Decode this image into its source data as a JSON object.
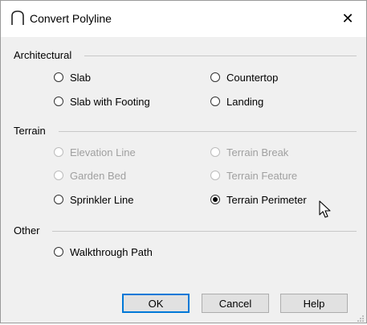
{
  "window": {
    "title": "Convert Polyline",
    "icon": "polyline-arc-icon",
    "close_label": "✕"
  },
  "groups": [
    {
      "label": "Architectural"
    },
    {
      "label": "Terrain"
    },
    {
      "label": "Other"
    }
  ],
  "options": {
    "slab": "Slab",
    "countertop": "Countertop",
    "slab_with_footing": "Slab with Footing",
    "landing": "Landing",
    "elevation_line": "Elevation Line",
    "terrain_break": "Terrain Break",
    "garden_bed": "Garden Bed",
    "terrain_feature": "Terrain Feature",
    "sprinkler_line": "Sprinkler Line",
    "terrain_perimeter": "Terrain Perimeter",
    "walkthrough_path": "Walkthrough Path"
  },
  "selected_option": "Terrain Perimeter",
  "buttons": {
    "ok": "OK",
    "cancel": "Cancel",
    "help": "Help"
  },
  "colors": {
    "default_button_border": "#0078d7",
    "disabled_text": "#a0a0a0",
    "dialog_bg": "#f0f0f0"
  }
}
